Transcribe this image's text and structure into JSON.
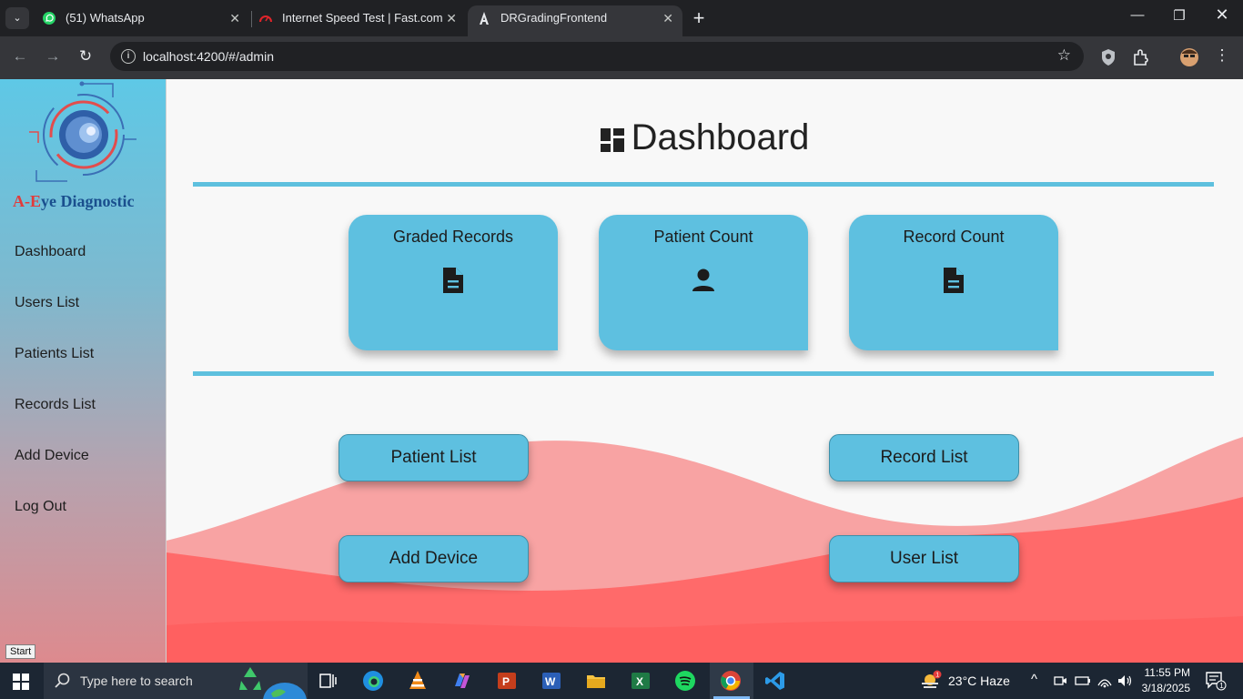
{
  "browser": {
    "tabs": [
      {
        "title": "(51) WhatsApp"
      },
      {
        "title": "Internet Speed Test | Fast.com"
      },
      {
        "title": "DRGradingFrontend"
      }
    ],
    "url": "localhost:4200/#/admin"
  },
  "sidebar": {
    "logo_text_a": "A-",
    "logo_text_e": "E",
    "logo_text_rest": "ye Diagnostic",
    "items": [
      {
        "label": "Dashboard"
      },
      {
        "label": "Users List"
      },
      {
        "label": "Patients List"
      },
      {
        "label": "Records List"
      },
      {
        "label": "Add Device"
      },
      {
        "label": "Log Out"
      }
    ]
  },
  "main": {
    "title": "Dashboard",
    "cards": [
      {
        "title": "Graded Records",
        "icon": "document-icon"
      },
      {
        "title": "Patient Count",
        "icon": "person-icon"
      },
      {
        "title": "Record Count",
        "icon": "document-icon"
      }
    ],
    "buttons": {
      "patient_list": "Patient List",
      "record_list": "Record List",
      "add_device": "Add Device",
      "user_list": "User List"
    }
  },
  "taskbar": {
    "tooltip": "Start",
    "search_placeholder": "Type here to search",
    "weather": "23°C  Haze",
    "time": "11:55 PM",
    "date": "3/18/2025",
    "notification_count": "1"
  },
  "colors": {
    "accent": "#5ec0e0",
    "wave_light": "#f8a3a3",
    "wave_dark": "#ff5a5a"
  }
}
